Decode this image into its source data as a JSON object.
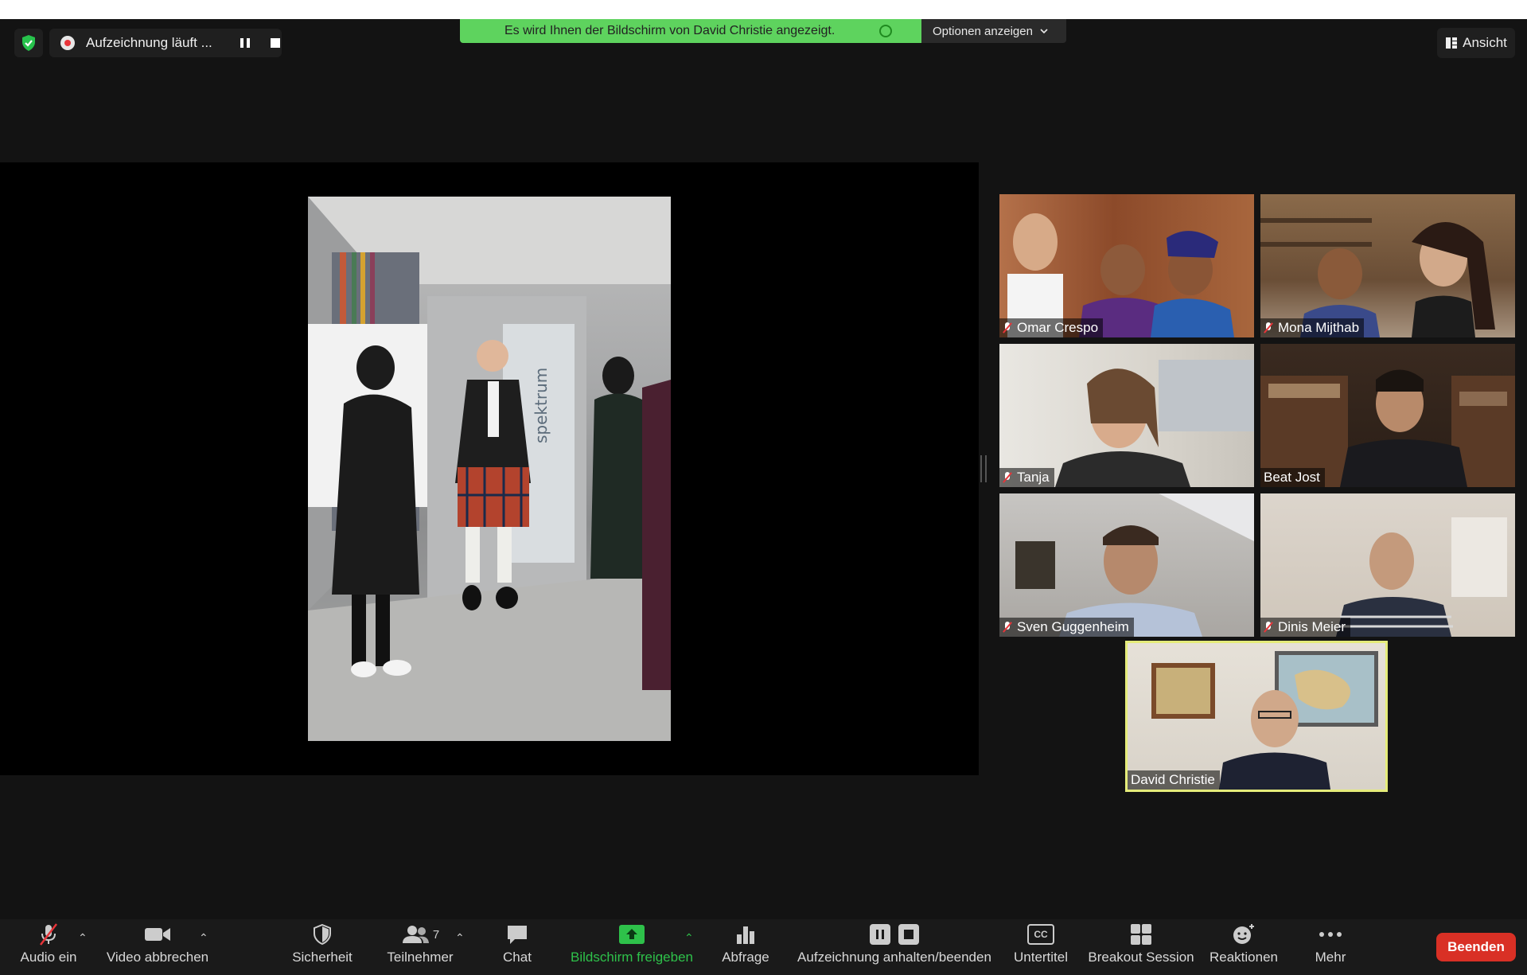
{
  "recording": {
    "status_text": "Aufzeichnung läuft ..."
  },
  "banner": {
    "text": "Es wird Ihnen der Bildschirm von David Christie angezeigt.",
    "options_label": "Optionen anzeigen"
  },
  "view_button": {
    "label": "Ansicht"
  },
  "shared_screen": {
    "wall_text": "spektrum"
  },
  "participants": [
    {
      "name": "Omar Crespo",
      "muted": true
    },
    {
      "name": "Mona Mijthab",
      "muted": true
    },
    {
      "name": "Tanja",
      "muted": true
    },
    {
      "name": "Beat Jost",
      "muted": false
    },
    {
      "name": "Sven Guggenheim",
      "muted": true
    },
    {
      "name": "Dinis Meier",
      "muted": true
    },
    {
      "name": "David Christie",
      "muted": false,
      "active_speaker": true
    }
  ],
  "toolbar": {
    "audio": "Audio ein",
    "video": "Video abbrechen",
    "security": "Sicherheit",
    "participants": "Teilnehmer",
    "participants_count": "7",
    "chat": "Chat",
    "share": "Bildschirm freigeben",
    "poll": "Abfrage",
    "record": "Aufzeichnung anhalten/beenden",
    "captions": "Untertitel",
    "captions_icon_text": "CC",
    "breakout": "Breakout Session",
    "reactions": "Reaktionen",
    "more": "Mehr",
    "end": "Beenden"
  },
  "colors": {
    "banner": "#5ed35e",
    "share_accent": "#2ec14a",
    "end_button": "#d93025",
    "active_speaker_border": "#e5ec7a",
    "mute_red": "#e8353a"
  }
}
